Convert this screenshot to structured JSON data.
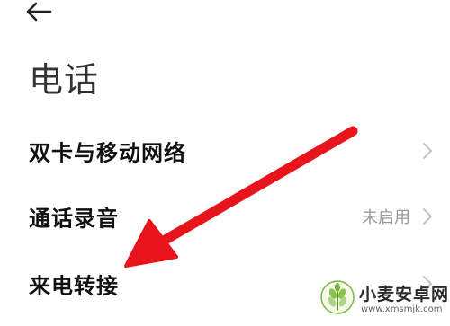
{
  "header": {
    "back_icon": "arrow-left-icon",
    "title": "电话"
  },
  "settings": [
    {
      "label": "双卡与移动网络",
      "status": ""
    },
    {
      "label": "通话录音",
      "status": "未启用"
    },
    {
      "label": "来电转接",
      "status": ""
    }
  ],
  "annotation": {
    "arrow_color": "#e8141b",
    "icon": "red-arrow-icon"
  },
  "watermark": {
    "name": "小麦安卓网",
    "url": "www.xmsmjk.com",
    "logo_icon": "wheat-logo-icon"
  }
}
